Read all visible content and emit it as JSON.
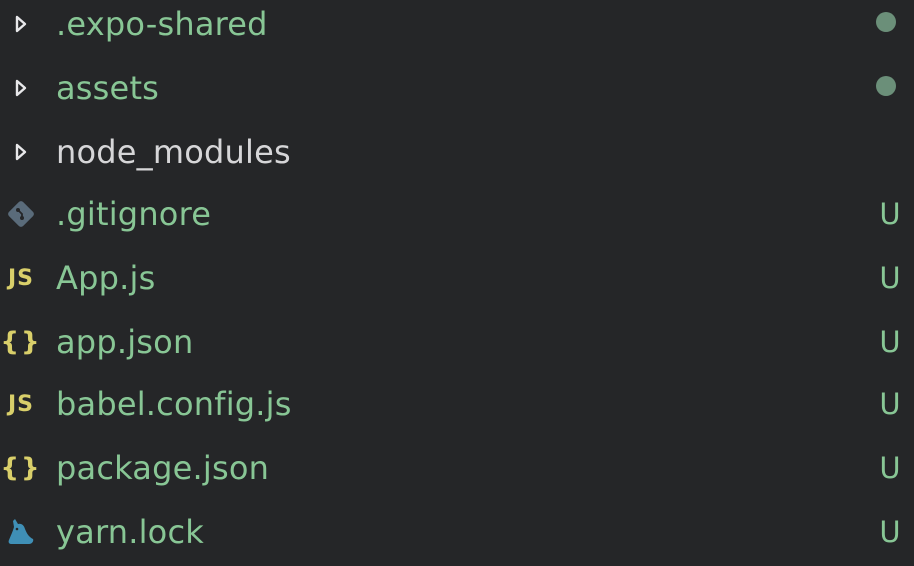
{
  "colors": {
    "background": "#252628",
    "modified": "#88c695",
    "untracked": "#88c695",
    "normal": "#d6d6d8",
    "dot": "#6b8f79",
    "chevron": "#e8e8ea",
    "js_icon": "#d9cf6a",
    "json_icon": "#d9cf6a",
    "git_icon": "#5a6b7a",
    "yarn_icon": "#3f8fb6"
  },
  "tree": {
    "items": [
      {
        "name": ".expo-shared",
        "kind": "folder",
        "icon": "chevron-right-icon",
        "status": "dot"
      },
      {
        "name": "assets",
        "kind": "folder",
        "icon": "chevron-right-icon",
        "status": "dot"
      },
      {
        "name": "node_modules",
        "kind": "folder",
        "icon": "chevron-right-icon",
        "status": ""
      },
      {
        "name": ".gitignore",
        "kind": "file",
        "icon": "git-icon",
        "status": "U"
      },
      {
        "name": "App.js",
        "kind": "file",
        "icon": "js-icon",
        "icon_text": "JS",
        "status": "U"
      },
      {
        "name": "app.json",
        "kind": "file",
        "icon": "json-icon",
        "icon_text": "{}",
        "status": "U"
      },
      {
        "name": "babel.config.js",
        "kind": "file",
        "icon": "js-icon",
        "icon_text": "JS",
        "status": "U"
      },
      {
        "name": "package.json",
        "kind": "file",
        "icon": "json-icon",
        "icon_text": "{}",
        "status": "U"
      },
      {
        "name": "yarn.lock",
        "kind": "file",
        "icon": "yarn-icon",
        "status": "U"
      }
    ]
  }
}
